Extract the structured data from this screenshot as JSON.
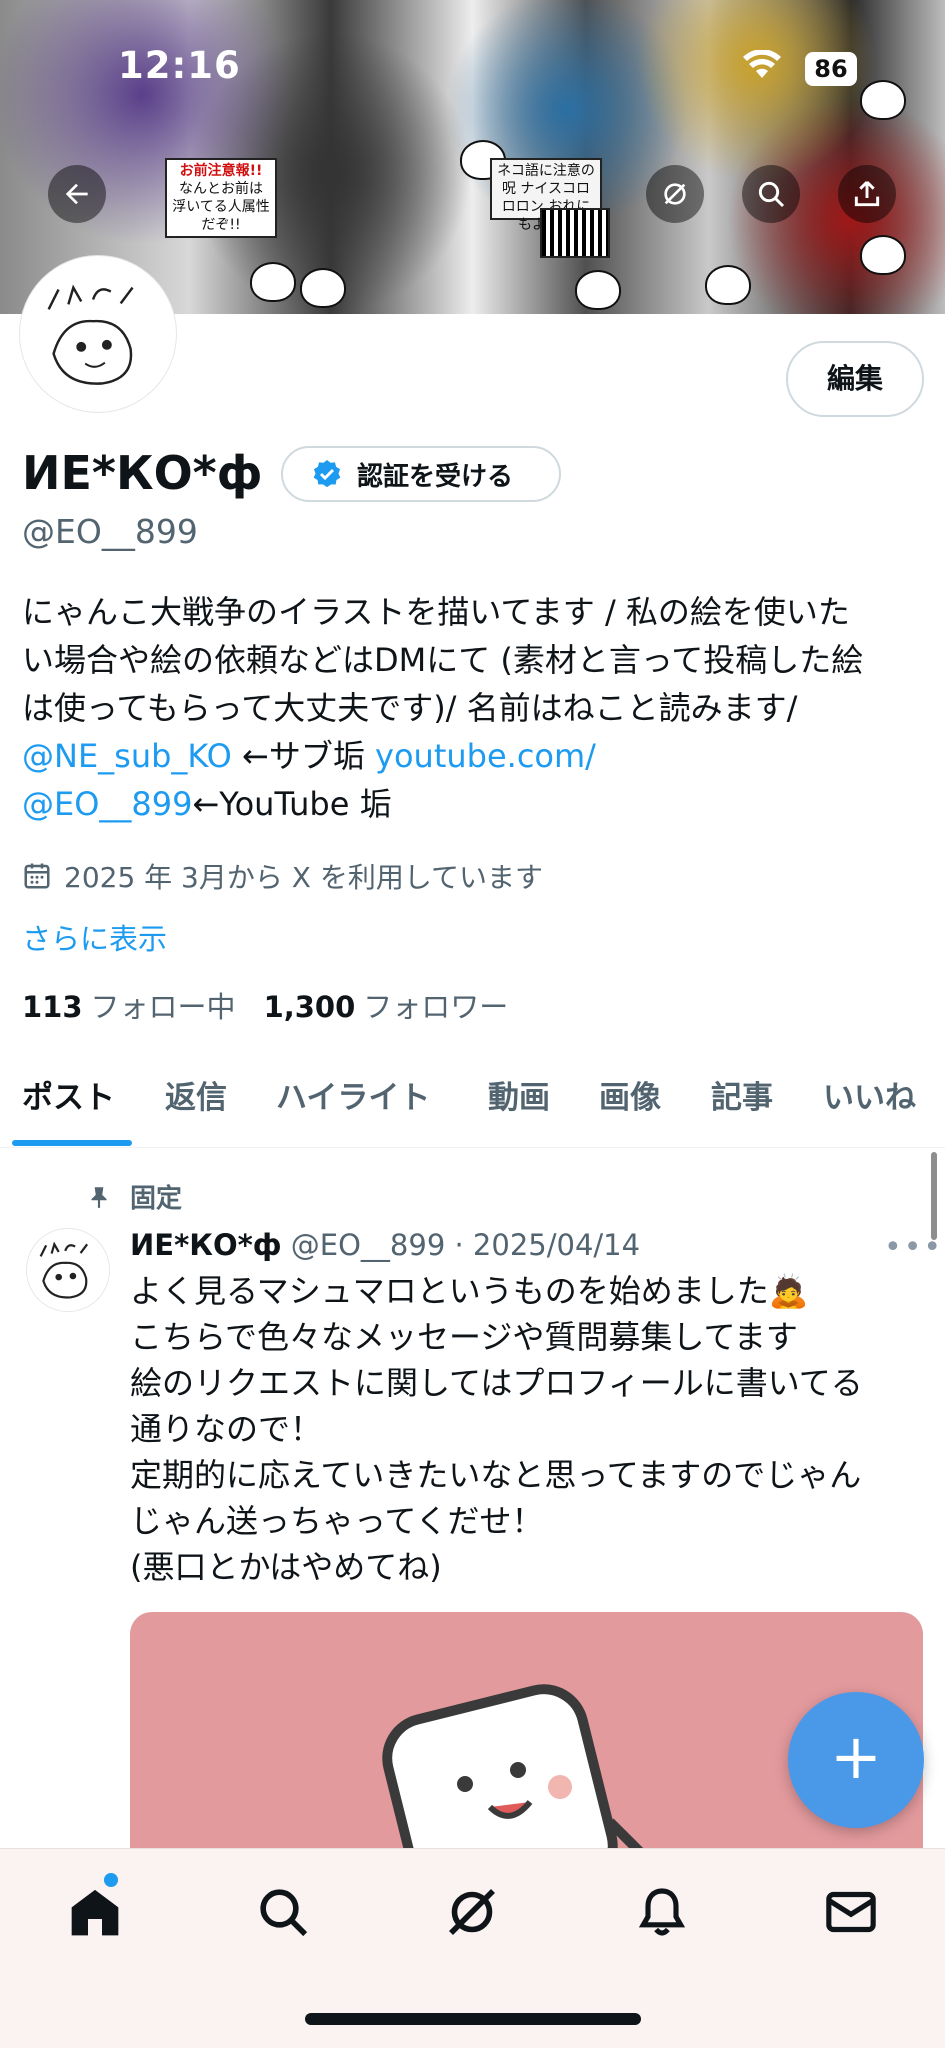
{
  "status_bar": {
    "time": "12:16",
    "battery": "86"
  },
  "banner": {
    "sticker_red_title": "お前注意報!!",
    "sticker_red_text": "なんとお前は 浮いてる人属性 だぞ!!",
    "sticker_sign_text": "ネコ語に注意の呪 ナイスコロロロン おれにもよこせ"
  },
  "header": {
    "back_icon": "arrow-left-icon",
    "grok_icon": "grok-icon",
    "search_icon": "search-icon",
    "share_icon": "share-icon"
  },
  "profile": {
    "edit_label": "編集",
    "display_name": "ИЕ*КО*ф",
    "verify_label": "認証を受ける",
    "handle": "@EO__899",
    "bio_line1": "にゃんこ大戦争のイラストを描いてます / 私の絵を使いた",
    "bio_line2": "い場合や絵の依頼などはDMにて (素材と言って投稿した絵",
    "bio_line3": "は使ってもらって大丈夫です)/ 名前はねこと読みます/",
    "bio_link1": "@NE_sub_KO",
    "bio_text4": " ←サブ垢 ",
    "bio_link2": "youtube.com/",
    "bio_link3": "@EO__899",
    "bio_text5": "←YouTube 垢",
    "joined": "2025 年 3月から X を利用しています",
    "more": "さらに表示",
    "following_count": "113",
    "following_label": "フォロー中",
    "followers_count": "1,300",
    "followers_label": "フォロワー"
  },
  "tabs": [
    "ポスト",
    "返信",
    "ハイライト",
    "動画",
    "画像",
    "記事",
    "いいね"
  ],
  "post": {
    "pinned_label": "固定",
    "name": "ИЕ*КО*ф",
    "meta": " @EO__899 · 2025/04/14",
    "lines": [
      "よく見るマシュマロというものを始めました🙇",
      "こちらで色々なメッセージや質問募集してます",
      "絵のリクエストに関してはプロフィールに書いてる",
      "通りなので！",
      "定期的に応えていきたいなと思ってますのでじゃん",
      "じゃん送っちゃってくだせ！",
      "(悪口とかはやめてね)"
    ],
    "more_icon": "more-icon"
  },
  "fab_label": "+",
  "bottom_nav": [
    "home-icon",
    "search-icon",
    "grok-icon",
    "bell-icon",
    "mail-icon"
  ],
  "colors": {
    "accent": "#1d9bf0",
    "fab": "#4a99e9",
    "media_bg": "#e39a9d"
  }
}
